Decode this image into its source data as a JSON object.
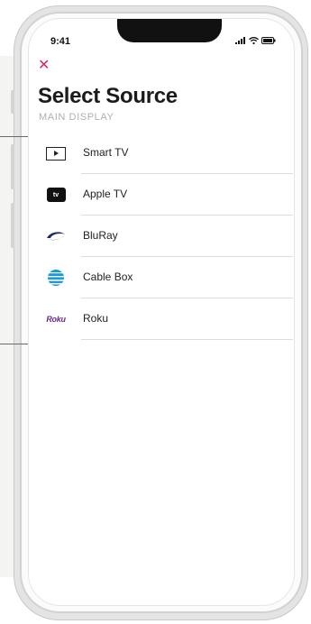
{
  "status": {
    "time": "9:41"
  },
  "header": {
    "close_glyph": "✕",
    "title": "Select Source",
    "subtitle": "MAIN DISPLAY"
  },
  "callouts": {
    "marker": "···"
  },
  "sources": [
    {
      "label": "Smart TV",
      "icon": "smart-tv-icon"
    },
    {
      "label": "Apple TV",
      "icon": "apple-tv-icon",
      "badge": "tv"
    },
    {
      "label": "BluRay",
      "icon": "bluray-icon"
    },
    {
      "label": "Cable Box",
      "icon": "att-globe-icon"
    },
    {
      "label": "Roku",
      "icon": "roku-logo",
      "badge": "Roku"
    }
  ],
  "colors": {
    "accent": "#e0245e",
    "att_blue": "#1a9ad6",
    "roku_purple": "#6a2a8c"
  }
}
